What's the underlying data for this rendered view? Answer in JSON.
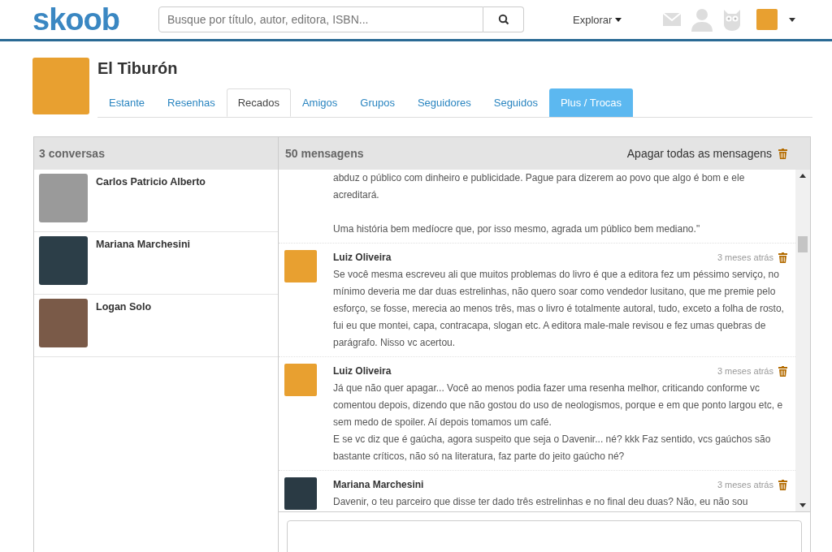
{
  "header": {
    "logo": "skoob",
    "search": {
      "placeholder": "Busque por título, autor, editora, ISBN..."
    },
    "explore": "Explorar"
  },
  "profile": {
    "name": "El Tiburón"
  },
  "tabs": [
    {
      "label": "Estante",
      "selected": false,
      "kind": "plain"
    },
    {
      "label": "Resenhas",
      "selected": false,
      "kind": "plain"
    },
    {
      "label": "Recados",
      "selected": true,
      "kind": "plain"
    },
    {
      "label": "Amigos",
      "selected": false,
      "kind": "plain"
    },
    {
      "label": "Grupos",
      "selected": false,
      "kind": "plain"
    },
    {
      "label": "Seguidores",
      "selected": false,
      "kind": "plain"
    },
    {
      "label": "Seguidos",
      "selected": false,
      "kind": "plain"
    },
    {
      "label": "Plus / Trocas",
      "selected": false,
      "kind": "highlight"
    }
  ],
  "conversations": {
    "title": "3 conversas",
    "items": [
      {
        "name": "Carlos Patricio Alberto"
      },
      {
        "name": "Mariana Marchesini"
      },
      {
        "name": "Logan Solo"
      }
    ]
  },
  "messages": {
    "title": "50 mensagens",
    "delete_all": "Apagar todas as mensagens",
    "items": [
      {
        "kind": "continuation",
        "text": "abduz o público com dinheiro e publicidade. Pague para dizerem ao povo que algo é bom e ele acreditará.\n\nUma história bem medíocre que, por isso mesmo, agrada um público bem mediano.\""
      },
      {
        "kind": "full",
        "author": "Luiz Oliveira",
        "time": "3 meses atrás",
        "text": "Se você mesma escreveu ali que muitos problemas do livro é que a editora fez um péssimo serviço, no mínimo deveria me dar duas estrelinhas, não quero soar como vendedor lusitano, que me premie pelo esforço, se fosse, merecia ao menos três, mas o livro é totalmente autoral, tudo, exceto a folha de rosto, fui eu que montei, capa, contracapa, slogan etc. A editora male-male revisou e fez umas quebras de parágrafo. Nisso vc acertou."
      },
      {
        "kind": "full",
        "author": "Luiz Oliveira",
        "time": "3 meses atrás",
        "text": "Já que não quer apagar... Você ao menos podia fazer uma resenha melhor, criticando conforme vc comentou depois, dizendo que não gostou do uso de neologismos, porque e em que ponto largou etc, e sem medo de spoiler. Aí depois tomamos um café.\nE se vc diz que é gaúcha, agora suspeito que seja o Davenir... né? kkk Faz sentido, vcs gaúchos são bastante críticos, não só na literatura, faz parte do jeito gaúcho né?"
      },
      {
        "kind": "full",
        "author": "Mariana Marchesini",
        "time": "3 meses atrás",
        "text": "Davenir, o teu parceiro que disse ter dado três estrelinhas e no final deu duas? Não, eu não sou"
      }
    ]
  }
}
